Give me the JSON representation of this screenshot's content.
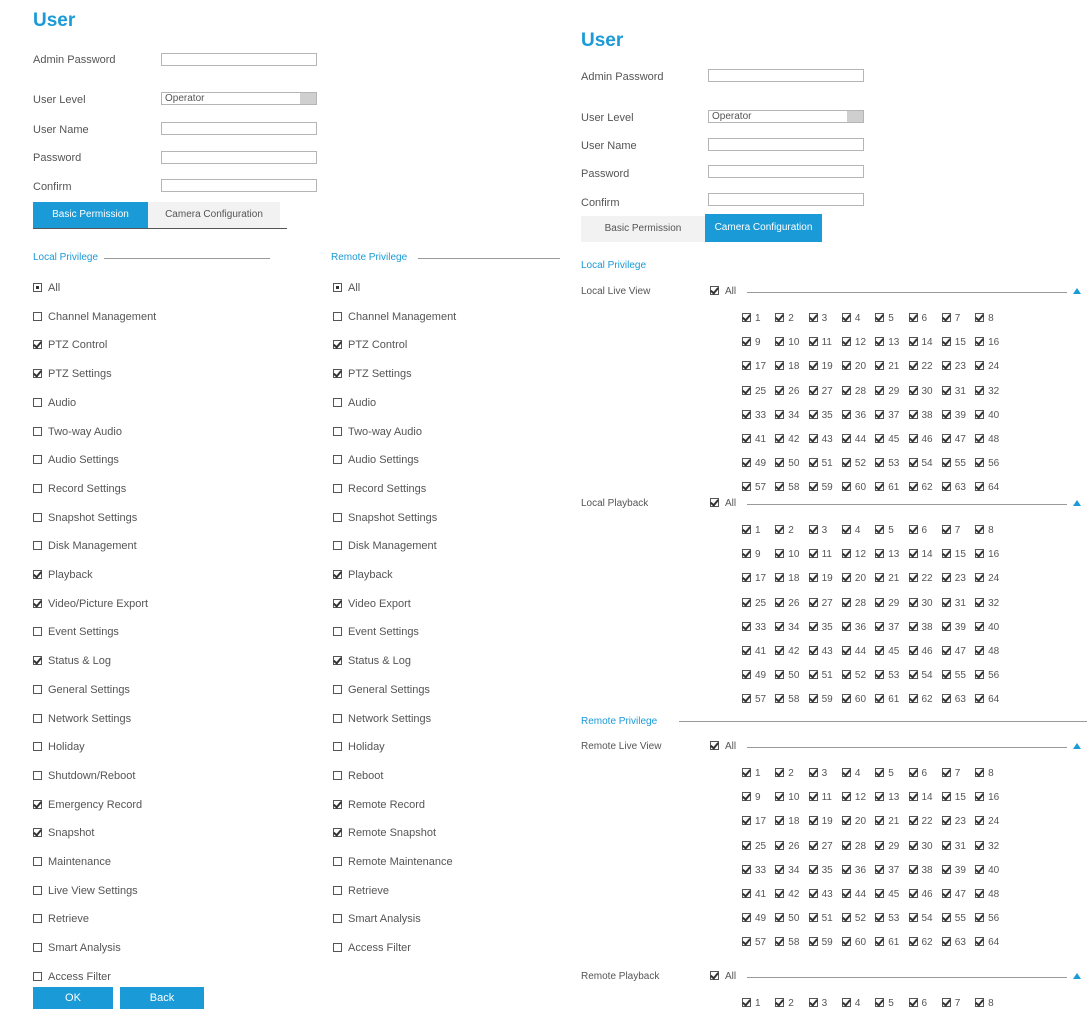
{
  "left": {
    "title": "User",
    "fields": {
      "admin_password": {
        "label": "Admin Password",
        "value": ""
      },
      "user_level": {
        "label": "User Level",
        "value": "Operator"
      },
      "user_name": {
        "label": "User Name",
        "value": ""
      },
      "password": {
        "label": "Password",
        "value": ""
      },
      "confirm": {
        "label": "Confirm",
        "value": ""
      }
    },
    "tabs": [
      "Basic Permission",
      "Camera Configuration"
    ],
    "local_title": "Local Privilege",
    "remote_title": "Remote Privilege",
    "local": [
      {
        "label": "All",
        "state": "partial"
      },
      {
        "label": "Channel Management",
        "state": "unchecked"
      },
      {
        "label": "PTZ Control",
        "state": "checked"
      },
      {
        "label": "PTZ Settings",
        "state": "checked"
      },
      {
        "label": "Audio",
        "state": "unchecked"
      },
      {
        "label": "Two-way Audio",
        "state": "unchecked"
      },
      {
        "label": "Audio Settings",
        "state": "unchecked"
      },
      {
        "label": "Record Settings",
        "state": "unchecked"
      },
      {
        "label": "Snapshot Settings",
        "state": "unchecked"
      },
      {
        "label": "Disk Management",
        "state": "unchecked"
      },
      {
        "label": "Playback",
        "state": "checked"
      },
      {
        "label": "Video/Picture Export",
        "state": "checked"
      },
      {
        "label": "Event Settings",
        "state": "unchecked"
      },
      {
        "label": "Status & Log",
        "state": "checked"
      },
      {
        "label": "General Settings",
        "state": "unchecked"
      },
      {
        "label": "Network Settings",
        "state": "unchecked"
      },
      {
        "label": "Holiday",
        "state": "unchecked"
      },
      {
        "label": "Shutdown/Reboot",
        "state": "unchecked"
      },
      {
        "label": "Emergency Record",
        "state": "checked"
      },
      {
        "label": "Snapshot",
        "state": "checked"
      },
      {
        "label": "Maintenance",
        "state": "unchecked"
      },
      {
        "label": "Live View Settings",
        "state": "unchecked"
      },
      {
        "label": "Retrieve",
        "state": "unchecked"
      },
      {
        "label": "Smart Analysis",
        "state": "unchecked"
      },
      {
        "label": "Access Filter",
        "state": "unchecked"
      }
    ],
    "remote": [
      {
        "label": "All",
        "state": "partial"
      },
      {
        "label": "Channel Management",
        "state": "unchecked"
      },
      {
        "label": "PTZ Control",
        "state": "checked"
      },
      {
        "label": "PTZ Settings",
        "state": "checked"
      },
      {
        "label": "Audio",
        "state": "unchecked"
      },
      {
        "label": "Two-way Audio",
        "state": "unchecked"
      },
      {
        "label": "Audio Settings",
        "state": "unchecked"
      },
      {
        "label": "Record Settings",
        "state": "unchecked"
      },
      {
        "label": "Snapshot Settings",
        "state": "unchecked"
      },
      {
        "label": "Disk Management",
        "state": "unchecked"
      },
      {
        "label": "Playback",
        "state": "checked"
      },
      {
        "label": "Video Export",
        "state": "checked"
      },
      {
        "label": "Event Settings",
        "state": "unchecked"
      },
      {
        "label": "Status & Log",
        "state": "checked"
      },
      {
        "label": "General Settings",
        "state": "unchecked"
      },
      {
        "label": "Network Settings",
        "state": "unchecked"
      },
      {
        "label": "Holiday",
        "state": "unchecked"
      },
      {
        "label": "Reboot",
        "state": "unchecked"
      },
      {
        "label": "Remote Record",
        "state": "checked"
      },
      {
        "label": "Remote Snapshot",
        "state": "checked"
      },
      {
        "label": "Remote Maintenance",
        "state": "unchecked"
      },
      {
        "label": "Retrieve",
        "state": "unchecked"
      },
      {
        "label": "Smart Analysis",
        "state": "unchecked"
      },
      {
        "label": "Access Filter",
        "state": "unchecked"
      }
    ],
    "buttons": {
      "ok": "OK",
      "back": "Back"
    }
  },
  "right": {
    "title": "User",
    "fields": {
      "admin_password": {
        "label": "Admin Password",
        "value": ""
      },
      "user_level": {
        "label": "User Level",
        "value": "Operator"
      },
      "user_name": {
        "label": "User Name",
        "value": ""
      },
      "password": {
        "label": "Password",
        "value": ""
      },
      "confirm": {
        "label": "Confirm",
        "value": ""
      }
    },
    "tabs": [
      "Basic Permission",
      "Camera Configuration"
    ],
    "local_title": "Local Privilege",
    "remote_title": "Remote Privilege",
    "all_label": "All",
    "groups": [
      {
        "label": "Local Live View",
        "channels": 64
      },
      {
        "label": "Local Playback",
        "channels": 64
      },
      {
        "label": "Remote Live View",
        "channels": 64
      },
      {
        "label": "Remote Playback",
        "channels": 8
      }
    ]
  },
  "colors": {
    "accent": "#1a9ad6"
  }
}
